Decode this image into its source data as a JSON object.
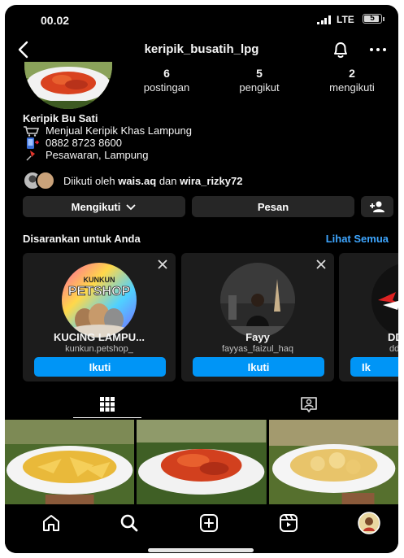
{
  "status_bar": {
    "time": "00.02",
    "network": "LTE",
    "battery": "5"
  },
  "header": {
    "username": "keripik_busatih_lpg"
  },
  "profile": {
    "stats": [
      {
        "number": "6",
        "label": "postingan"
      },
      {
        "number": "5",
        "label": "pengikut"
      },
      {
        "number": "2",
        "label": "mengikuti"
      }
    ],
    "bio": {
      "name": "Keripik Bu Sati",
      "line1": "Menjual Keripik Khas Lampung",
      "line2": "0882 8723 8600",
      "line3": "Pesawaran, Lampung"
    },
    "followed_by": {
      "prefix": "Diikuti oleh",
      "user1": "wais.aq",
      "joiner": "dan",
      "user2": "wira_rizky72"
    }
  },
  "actions": {
    "following": "Mengikuti",
    "message": "Pesan"
  },
  "suggestions": {
    "title": "Disarankan untuk Anda",
    "see_all": "Lihat Semua",
    "cards": [
      {
        "title": "KUCING LAMPU...",
        "handle": "kunkun.petshop_",
        "button": "Ikuti",
        "logo_top": "KUNKUN",
        "logo_main": "PETSHOP"
      },
      {
        "title": "Fayy",
        "handle": "fayyas_faizul_haq",
        "button": "Ikuti"
      },
      {
        "title": "DD",
        "handle": "dd_",
        "button": "Ik"
      }
    ]
  },
  "icons": {
    "back": "chevron-left-icon",
    "bell": "bell-icon",
    "more": "more-horizontal-icon",
    "add_user": "add-user-icon",
    "grid": "grid-icon",
    "tagged": "tagged-icon",
    "home": "home-icon",
    "search": "search-icon",
    "create": "plus-square-icon",
    "reels": "reels-icon",
    "profile": "profile-avatar-icon"
  },
  "colors": {
    "accent": "#0095f6",
    "link": "#3ea6ff",
    "background": "#000000",
    "button": "#262626"
  }
}
